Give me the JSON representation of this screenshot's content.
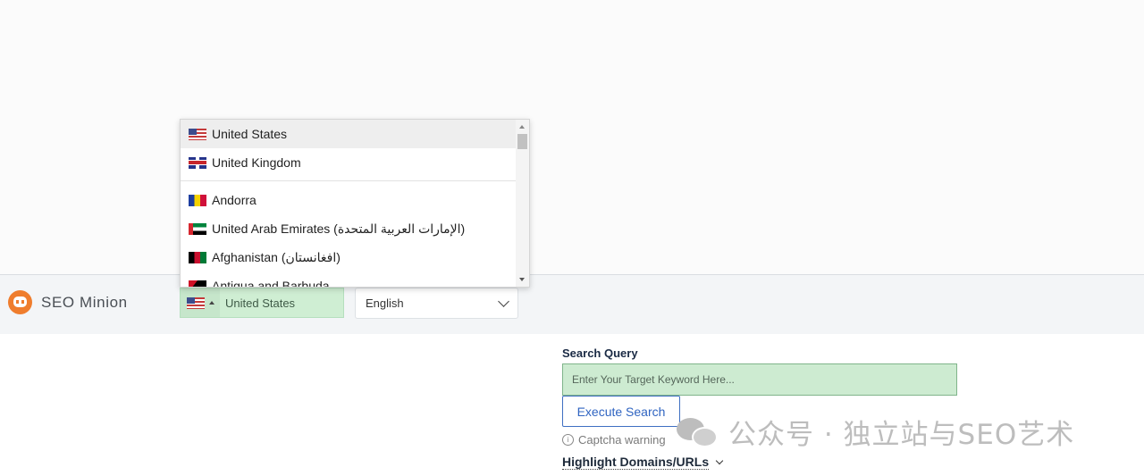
{
  "app": {
    "name": "SEO Minion"
  },
  "country_select": {
    "selected": "United States",
    "flag": "us-flag-icon"
  },
  "language_select": {
    "selected": "English"
  },
  "country_dropdown": {
    "items": [
      {
        "label": "United States",
        "flag": "us-flag-icon",
        "selected": true
      },
      {
        "label": "United Kingdom",
        "flag": "gb-flag-icon",
        "selected": false
      },
      {
        "label": "Andorra",
        "flag": "ad-flag-icon",
        "selected": false
      },
      {
        "label": "United Arab Emirates (الإمارات العربية المتحدة)",
        "flag": "ae-flag-icon",
        "selected": false
      },
      {
        "label": "Afghanistan (افغانستان)",
        "flag": "af-flag-icon",
        "selected": false
      },
      {
        "label": "Antigua and Barbuda",
        "flag": "ag-flag-icon",
        "selected": false
      }
    ]
  },
  "search": {
    "label": "Search Query",
    "placeholder": "Enter Your Target Keyword Here...",
    "execute_label": "Execute Search",
    "captcha_warning": "Captcha warning",
    "highlight_label": "Highlight Domains/URLs"
  },
  "watermark": {
    "text": "公众号 · 独立站与SEO艺术"
  },
  "colors": {
    "brand": "#ef7d2d",
    "input_green": "#cdebd1",
    "button_blue": "#2f64c1"
  }
}
